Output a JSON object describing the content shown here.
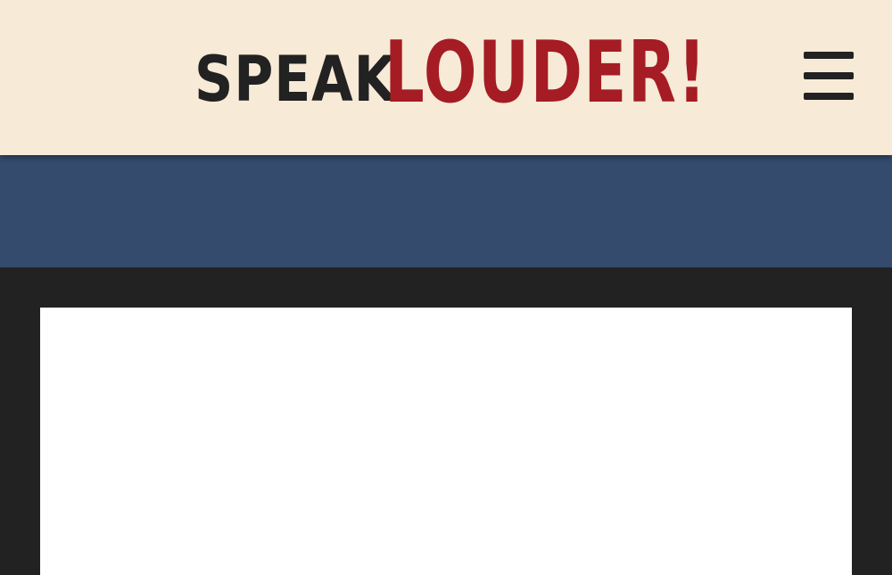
{
  "header": {
    "logo": {
      "part1": "SPEAK",
      "part2": "LOUDER!",
      "part1_color": "#222222",
      "part2_color": "#a51c24"
    },
    "menu_button": {
      "icon": "hamburger-menu-icon",
      "color": "#222222"
    }
  },
  "theme": {
    "header_bg": "#f7ead6",
    "nav_band_bg": "#344b6d",
    "page_bg": "#222222",
    "card_bg": "#ffffff"
  }
}
